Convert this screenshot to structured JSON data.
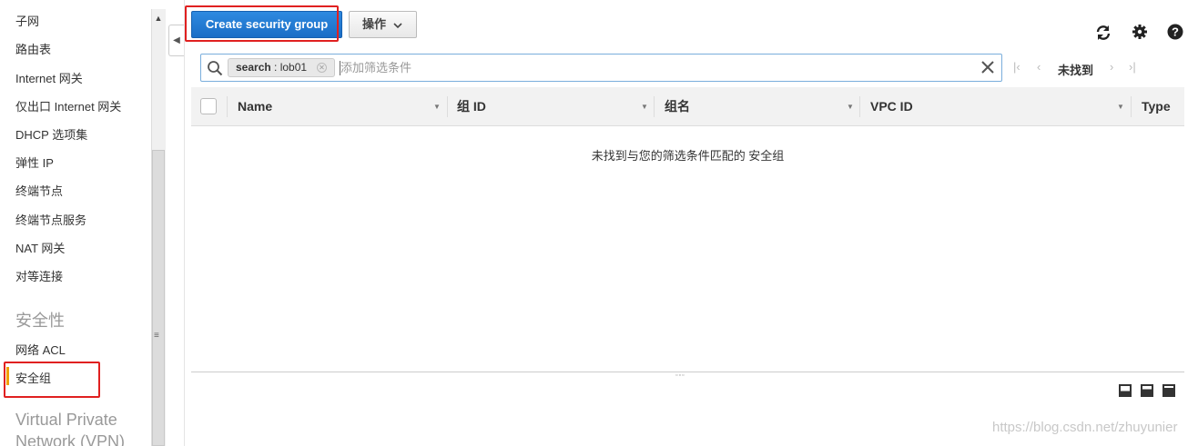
{
  "sidebar": {
    "items": [
      {
        "label": "子网"
      },
      {
        "label": "路由表"
      },
      {
        "label": "Internet 网关"
      },
      {
        "label": "仅出口 Internet 网关"
      },
      {
        "label": "DHCP 选项集"
      },
      {
        "label": "弹性 IP"
      },
      {
        "label": "终端节点"
      },
      {
        "label": "终端节点服务"
      },
      {
        "label": "NAT 网关"
      },
      {
        "label": "对等连接"
      }
    ],
    "security_section": "安全性",
    "security_items": [
      {
        "label": "网络 ACL"
      },
      {
        "label": "安全组",
        "active": true
      }
    ],
    "vpn_section": "Virtual Private Network (VPN)"
  },
  "toolbar": {
    "create_label": "Create security group",
    "actions_label": "操作",
    "icons": [
      "refresh-icon",
      "gear-icon",
      "help-icon"
    ]
  },
  "search": {
    "token_key": "search",
    "token_value": "lob01",
    "placeholder": "添加筛选条件"
  },
  "pager": {
    "status": "未找到"
  },
  "table": {
    "columns": [
      "Name",
      "组 ID",
      "组名",
      "VPC ID",
      "Type"
    ],
    "empty_message": "未找到与您的筛选条件匹配的 安全组"
  },
  "watermark": "https://blog.csdn.net/zhuyunier",
  "colors": {
    "primary_button": "#1a6ec6",
    "active_marker": "#f0a000",
    "highlight_box": "#e02020"
  }
}
